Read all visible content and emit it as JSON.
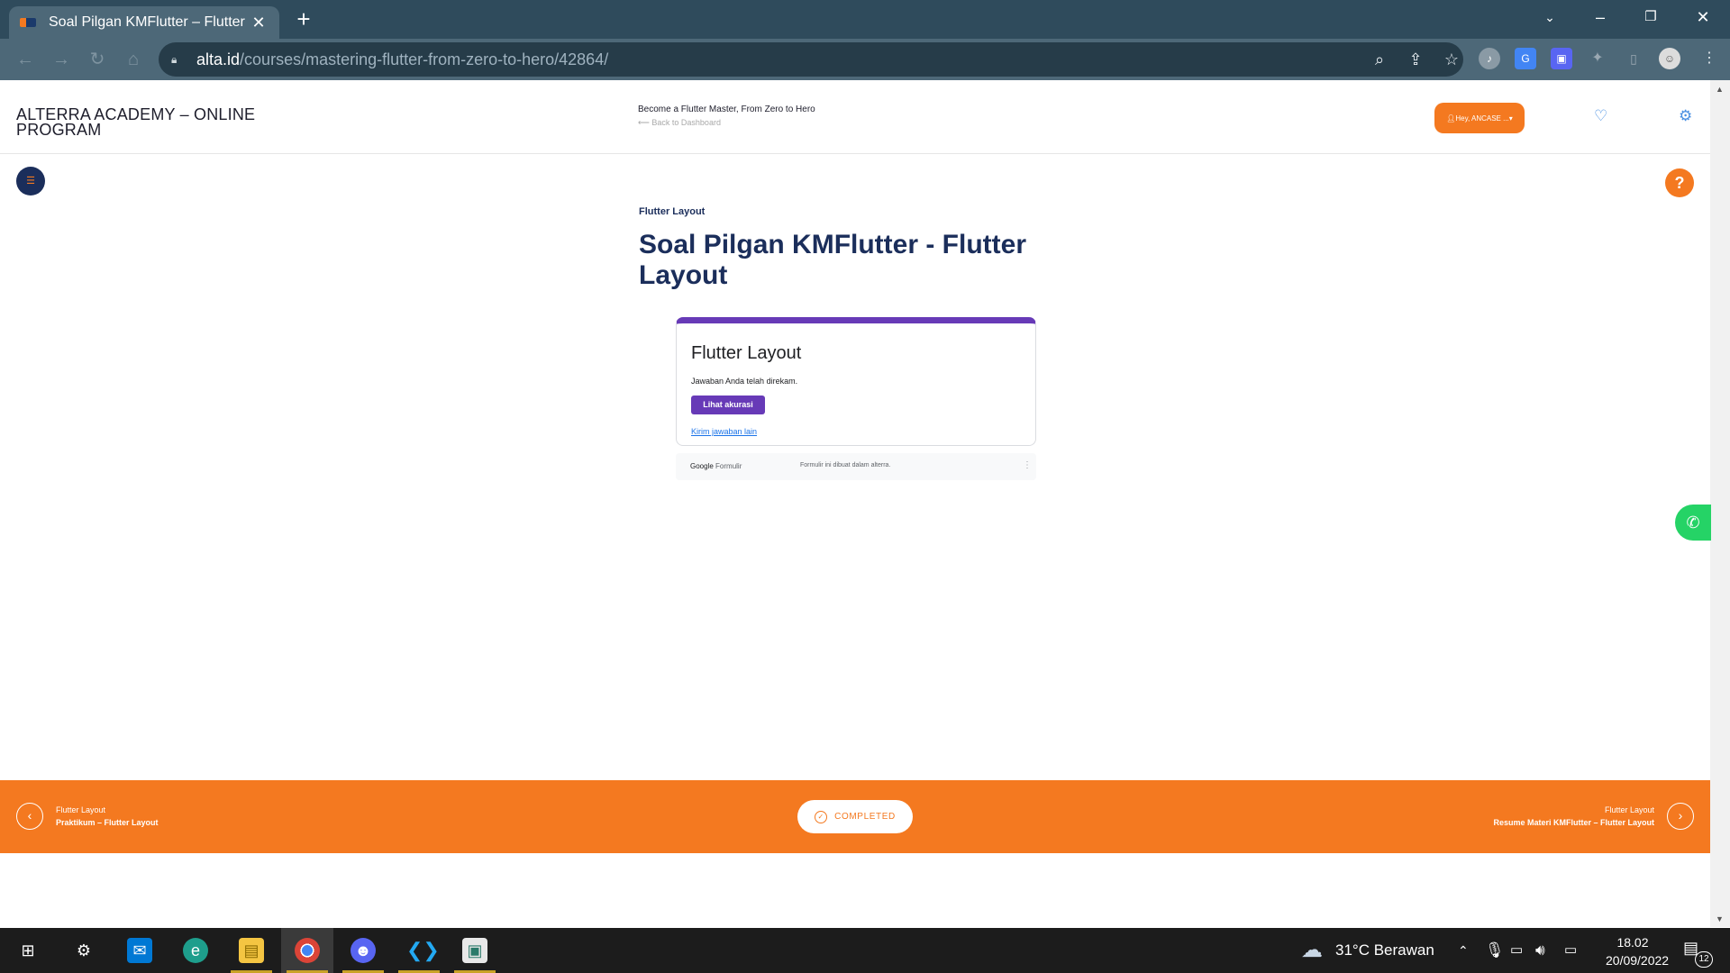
{
  "browser": {
    "tab_title": "Soal Pilgan KMFlutter – Flutter Layout",
    "tab_close": "✕",
    "new_tab": "+",
    "url_domain": "alta.id",
    "url_path": "/courses/mastering-flutter-from-zero-to-hero/42864/"
  },
  "header": {
    "brand": "ALTERRA ACADEMY – ONLINE PROGRAM",
    "course_title": "Become a Flutter Master, From Zero to Hero",
    "back_link": "Back to Dashboard",
    "user_button": "Hey, ANCASE ..."
  },
  "lesson": {
    "category": "Flutter Layout",
    "title": "Soal Pilgan KMFlutter - Flutter Layout"
  },
  "form": {
    "title": "Flutter Layout",
    "message": "Jawaban Anda telah direkam.",
    "view_button": "Lihat akurasi",
    "resubmit_link": "Kirim jawaban lain",
    "footer_brand": "Google",
    "footer_brand_suffix": "Formulir",
    "footer_note": "Formulir ini dibuat dalam alterra."
  },
  "lesson_nav": {
    "prev_category": "Flutter Layout",
    "prev_title": "Praktikum – Flutter Layout",
    "status": "COMPLETED",
    "next_category": "Flutter Layout",
    "next_title": "Resume Materi KMFlutter – Flutter Layout"
  },
  "taskbar": {
    "weather": "31°C  Berawan",
    "time": "18.02",
    "date": "20/09/2022",
    "notification_count": "12"
  },
  "colors": {
    "brand_orange": "#f47920",
    "brand_navy": "#1b2e5b",
    "form_purple": "#673ab7"
  }
}
